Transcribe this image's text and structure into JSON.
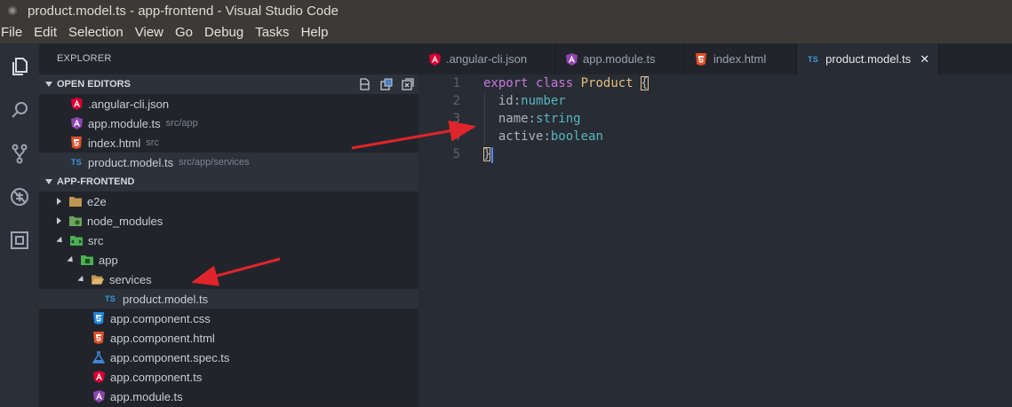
{
  "window": {
    "title": "product.model.ts - app-frontend - Visual Studio Code"
  },
  "menu": [
    "File",
    "Edit",
    "Selection",
    "View",
    "Go",
    "Debug",
    "Tasks",
    "Help"
  ],
  "activity_icons": [
    "explorer-icon",
    "search-icon",
    "source-control-icon",
    "debug-icon",
    "extensions-icon"
  ],
  "explorer": {
    "header": "EXPLORER",
    "open_editors": {
      "title": "OPEN EDITORS",
      "items": [
        {
          "name": ".angular-cli.json",
          "desc": "",
          "icon": "angular"
        },
        {
          "name": "app.module.ts",
          "desc": "src/app",
          "icon": "angular-purple"
        },
        {
          "name": "index.html",
          "desc": "src",
          "icon": "html"
        },
        {
          "name": "product.model.ts",
          "desc": "src/app/services",
          "icon": "ts"
        }
      ]
    },
    "project": {
      "title": "APP-FRONTEND",
      "tree": [
        {
          "name": "e2e"
        },
        {
          "name": "node_modules"
        },
        {
          "name": "src"
        },
        {
          "name": "app"
        },
        {
          "name": "services"
        },
        {
          "name": "product.model.ts"
        },
        {
          "name": "app.component.css"
        },
        {
          "name": "app.component.html"
        },
        {
          "name": "app.component.spec.ts"
        },
        {
          "name": "app.component.ts"
        },
        {
          "name": "app.module.ts"
        }
      ]
    }
  },
  "tabs": [
    {
      "label": ".angular-cli.json",
      "active": false
    },
    {
      "label": "app.module.ts",
      "active": false
    },
    {
      "label": "index.html",
      "active": false
    },
    {
      "label": "product.model.ts",
      "active": true
    }
  ],
  "ts_badge": "TS",
  "close_glyph": "✕",
  "editor": {
    "line_numbers": [
      "1",
      "2",
      "3",
      "4",
      "5"
    ],
    "code": {
      "l1_kw1": "export",
      "l1_kw2": "class",
      "l1_name": "Product",
      "l1_brace": "{",
      "l2_prop": "id",
      "l2_type": "number",
      "l3_prop": "name",
      "l3_type": "string",
      "l4_prop": "active",
      "l4_type": "boolean",
      "l5_brace": "}",
      "colon": ":"
    }
  },
  "colors": {
    "annotation_arrow": "#e0242b",
    "keyword": "#c678dd",
    "class_name": "#e5c07b",
    "type": "#56b6c2"
  }
}
